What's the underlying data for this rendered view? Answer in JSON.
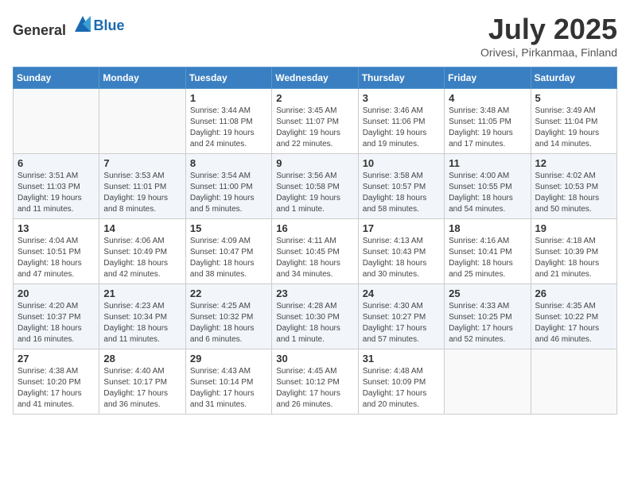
{
  "app": {
    "name_general": "General",
    "name_blue": "Blue"
  },
  "header": {
    "month_year": "July 2025",
    "location": "Orivesi, Pirkanmaa, Finland"
  },
  "columns": [
    "Sunday",
    "Monday",
    "Tuesday",
    "Wednesday",
    "Thursday",
    "Friday",
    "Saturday"
  ],
  "weeks": [
    [
      {
        "day": "",
        "info": ""
      },
      {
        "day": "",
        "info": ""
      },
      {
        "day": "1",
        "info": "Sunrise: 3:44 AM\nSunset: 11:08 PM\nDaylight: 19 hours\nand 24 minutes."
      },
      {
        "day": "2",
        "info": "Sunrise: 3:45 AM\nSunset: 11:07 PM\nDaylight: 19 hours\nand 22 minutes."
      },
      {
        "day": "3",
        "info": "Sunrise: 3:46 AM\nSunset: 11:06 PM\nDaylight: 19 hours\nand 19 minutes."
      },
      {
        "day": "4",
        "info": "Sunrise: 3:48 AM\nSunset: 11:05 PM\nDaylight: 19 hours\nand 17 minutes."
      },
      {
        "day": "5",
        "info": "Sunrise: 3:49 AM\nSunset: 11:04 PM\nDaylight: 19 hours\nand 14 minutes."
      }
    ],
    [
      {
        "day": "6",
        "info": "Sunrise: 3:51 AM\nSunset: 11:03 PM\nDaylight: 19 hours\nand 11 minutes."
      },
      {
        "day": "7",
        "info": "Sunrise: 3:53 AM\nSunset: 11:01 PM\nDaylight: 19 hours\nand 8 minutes."
      },
      {
        "day": "8",
        "info": "Sunrise: 3:54 AM\nSunset: 11:00 PM\nDaylight: 19 hours\nand 5 minutes."
      },
      {
        "day": "9",
        "info": "Sunrise: 3:56 AM\nSunset: 10:58 PM\nDaylight: 19 hours\nand 1 minute."
      },
      {
        "day": "10",
        "info": "Sunrise: 3:58 AM\nSunset: 10:57 PM\nDaylight: 18 hours\nand 58 minutes."
      },
      {
        "day": "11",
        "info": "Sunrise: 4:00 AM\nSunset: 10:55 PM\nDaylight: 18 hours\nand 54 minutes."
      },
      {
        "day": "12",
        "info": "Sunrise: 4:02 AM\nSunset: 10:53 PM\nDaylight: 18 hours\nand 50 minutes."
      }
    ],
    [
      {
        "day": "13",
        "info": "Sunrise: 4:04 AM\nSunset: 10:51 PM\nDaylight: 18 hours\nand 47 minutes."
      },
      {
        "day": "14",
        "info": "Sunrise: 4:06 AM\nSunset: 10:49 PM\nDaylight: 18 hours\nand 42 minutes."
      },
      {
        "day": "15",
        "info": "Sunrise: 4:09 AM\nSunset: 10:47 PM\nDaylight: 18 hours\nand 38 minutes."
      },
      {
        "day": "16",
        "info": "Sunrise: 4:11 AM\nSunset: 10:45 PM\nDaylight: 18 hours\nand 34 minutes."
      },
      {
        "day": "17",
        "info": "Sunrise: 4:13 AM\nSunset: 10:43 PM\nDaylight: 18 hours\nand 30 minutes."
      },
      {
        "day": "18",
        "info": "Sunrise: 4:16 AM\nSunset: 10:41 PM\nDaylight: 18 hours\nand 25 minutes."
      },
      {
        "day": "19",
        "info": "Sunrise: 4:18 AM\nSunset: 10:39 PM\nDaylight: 18 hours\nand 21 minutes."
      }
    ],
    [
      {
        "day": "20",
        "info": "Sunrise: 4:20 AM\nSunset: 10:37 PM\nDaylight: 18 hours\nand 16 minutes."
      },
      {
        "day": "21",
        "info": "Sunrise: 4:23 AM\nSunset: 10:34 PM\nDaylight: 18 hours\nand 11 minutes."
      },
      {
        "day": "22",
        "info": "Sunrise: 4:25 AM\nSunset: 10:32 PM\nDaylight: 18 hours\nand 6 minutes."
      },
      {
        "day": "23",
        "info": "Sunrise: 4:28 AM\nSunset: 10:30 PM\nDaylight: 18 hours\nand 1 minute."
      },
      {
        "day": "24",
        "info": "Sunrise: 4:30 AM\nSunset: 10:27 PM\nDaylight: 17 hours\nand 57 minutes."
      },
      {
        "day": "25",
        "info": "Sunrise: 4:33 AM\nSunset: 10:25 PM\nDaylight: 17 hours\nand 52 minutes."
      },
      {
        "day": "26",
        "info": "Sunrise: 4:35 AM\nSunset: 10:22 PM\nDaylight: 17 hours\nand 46 minutes."
      }
    ],
    [
      {
        "day": "27",
        "info": "Sunrise: 4:38 AM\nSunset: 10:20 PM\nDaylight: 17 hours\nand 41 minutes."
      },
      {
        "day": "28",
        "info": "Sunrise: 4:40 AM\nSunset: 10:17 PM\nDaylight: 17 hours\nand 36 minutes."
      },
      {
        "day": "29",
        "info": "Sunrise: 4:43 AM\nSunset: 10:14 PM\nDaylight: 17 hours\nand 31 minutes."
      },
      {
        "day": "30",
        "info": "Sunrise: 4:45 AM\nSunset: 10:12 PM\nDaylight: 17 hours\nand 26 minutes."
      },
      {
        "day": "31",
        "info": "Sunrise: 4:48 AM\nSunset: 10:09 PM\nDaylight: 17 hours\nand 20 minutes."
      },
      {
        "day": "",
        "info": ""
      },
      {
        "day": "",
        "info": ""
      }
    ]
  ]
}
